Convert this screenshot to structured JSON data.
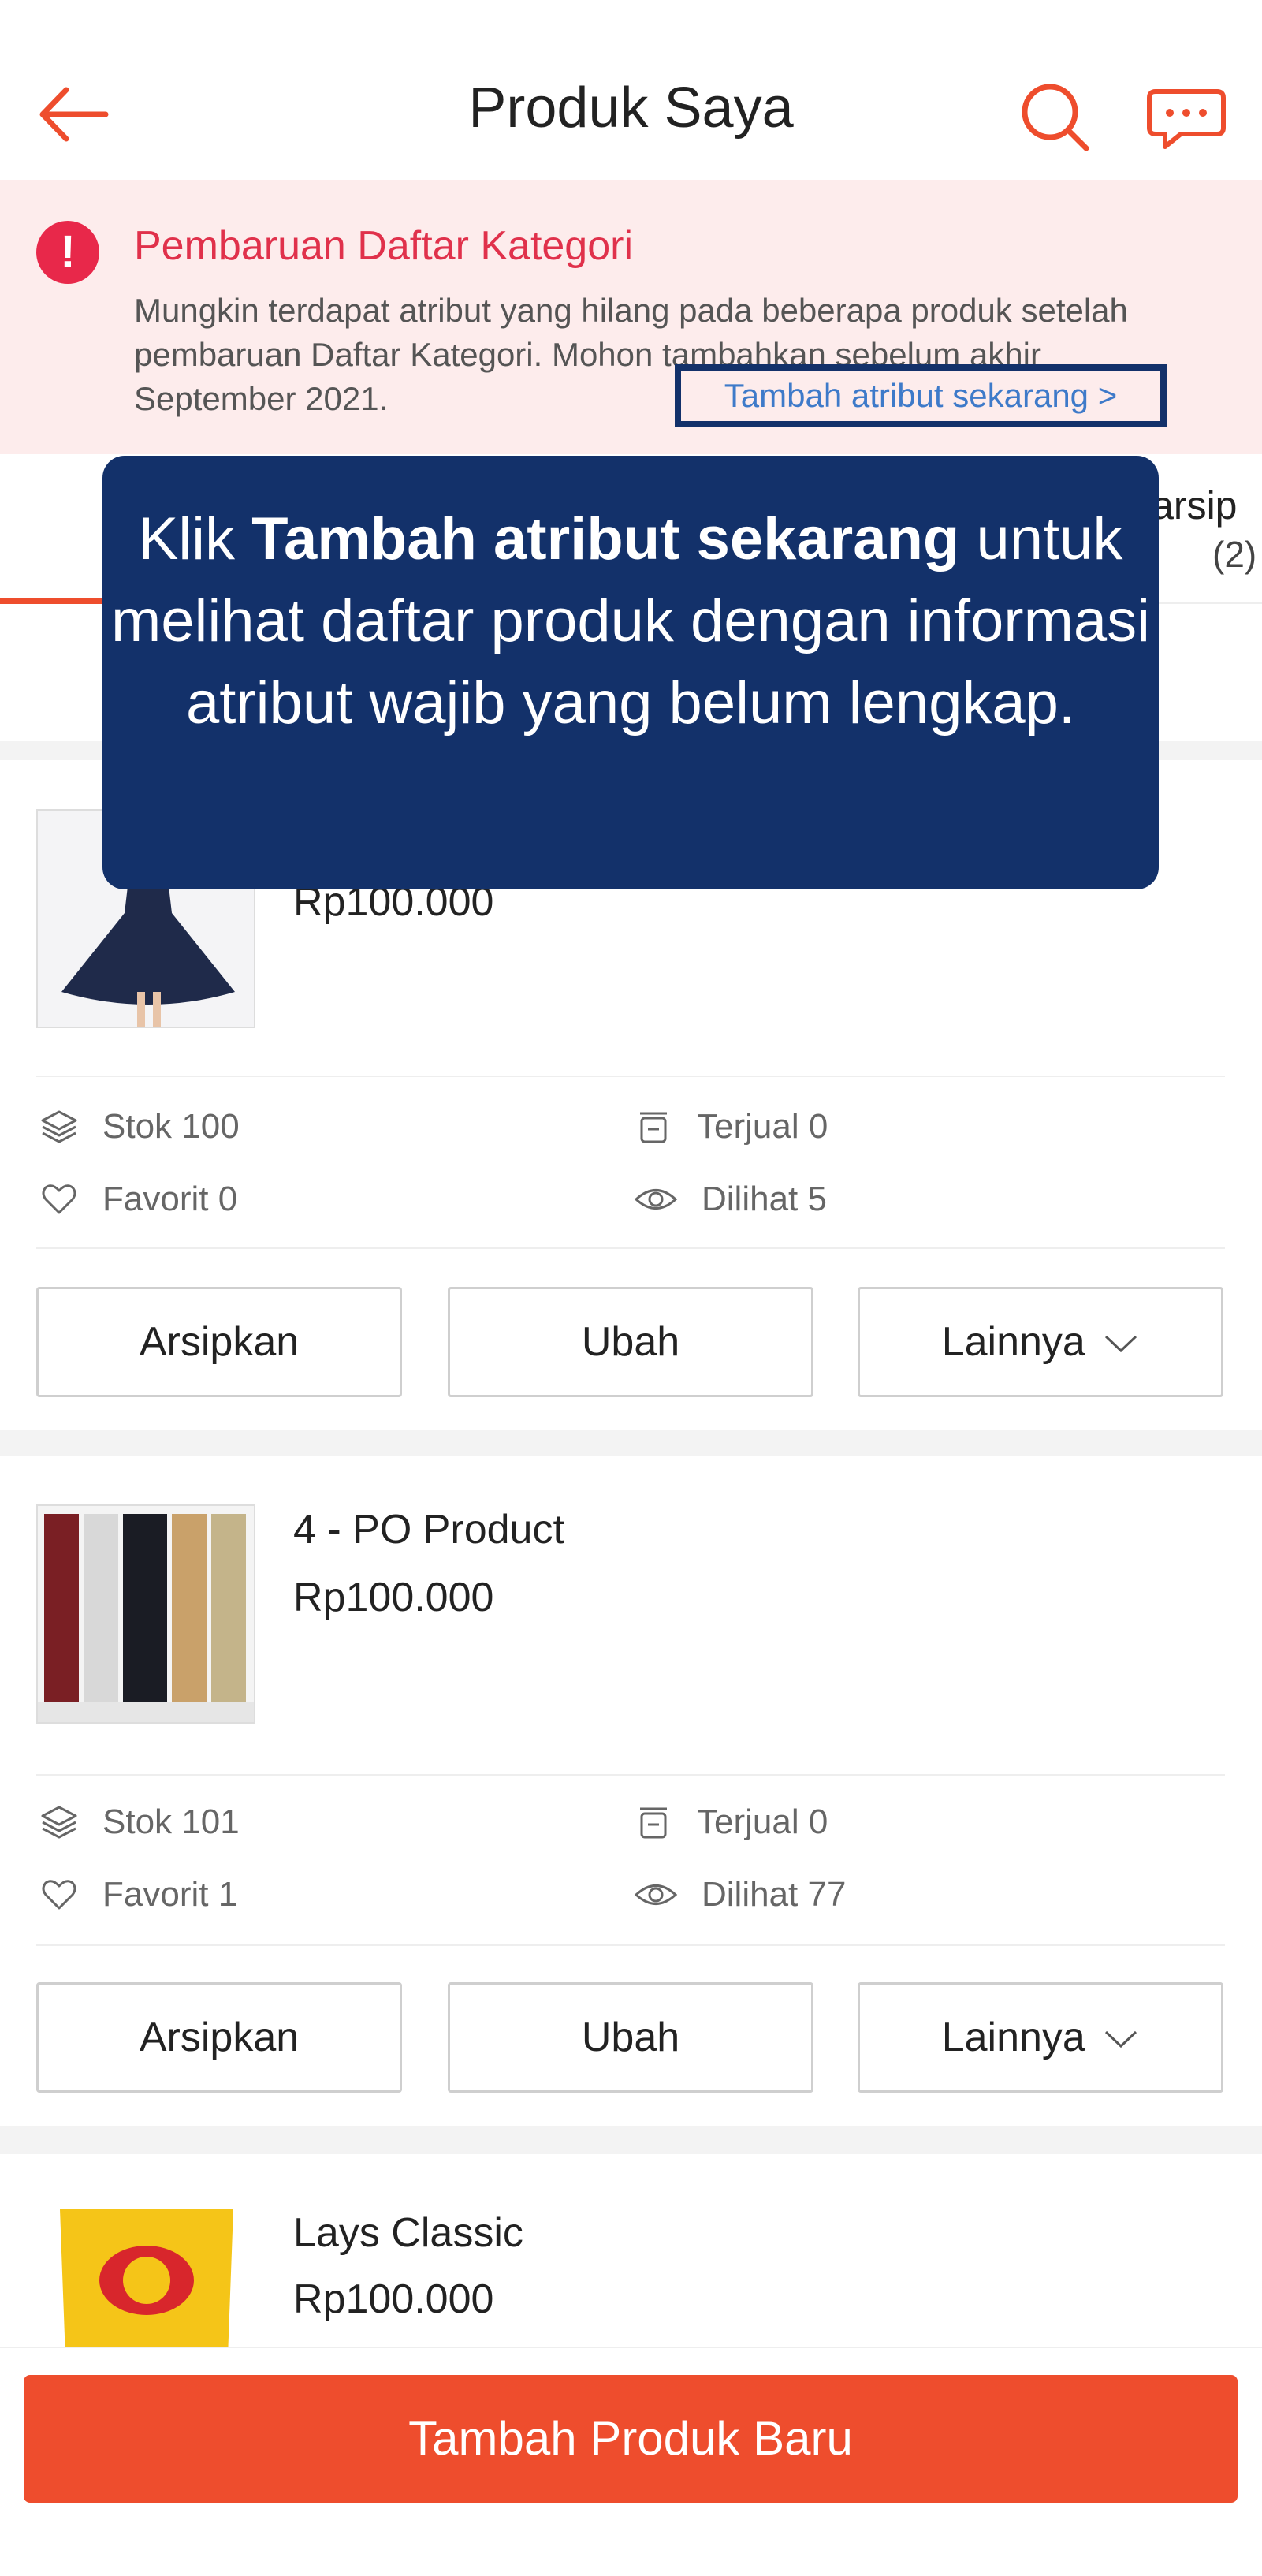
{
  "header": {
    "title": "Produk Saya"
  },
  "banner": {
    "title": "Pembaruan Daftar Kategori",
    "body": "Mungkin terdapat atribut yang hilang pada beberapa produk setelah pembaruan Daftar Kategori. Mohon tambahkan sebelum akhir September 2021.",
    "link": "Tambah atribut sekarang >"
  },
  "tabs": {
    "archive_label": "iarsip",
    "archive_count": "(2)"
  },
  "tooltip": {
    "prefix": "Klik ",
    "bold": "Tambah atribut sekarang",
    "suffix": " untuk melihat daftar produk dengan informasi atribut wajib yang belum lengkap."
  },
  "products": [
    {
      "name": "",
      "price": "Rp100.000",
      "stock": "Stok 100",
      "sold": "Terjual 0",
      "favorite": "Favorit 0",
      "views": "Dilihat 5"
    },
    {
      "name": "4 - PO Product",
      "price": "Rp100.000",
      "stock": "Stok 101",
      "sold": "Terjual 0",
      "favorite": "Favorit 1",
      "views": "Dilihat 77"
    },
    {
      "name": "Lays Classic",
      "price": "Rp100.000"
    }
  ],
  "actions": {
    "archive": "Arsipkan",
    "edit": "Ubah",
    "more": "Lainnya"
  },
  "footer": {
    "add_button": "Tambah Produk Baru"
  },
  "colors": {
    "accent": "#ee4d2d",
    "tooltip_bg": "#13316a",
    "banner_bg": "#fdecec",
    "banner_title": "#e0314b",
    "link": "#3e7ac9"
  }
}
